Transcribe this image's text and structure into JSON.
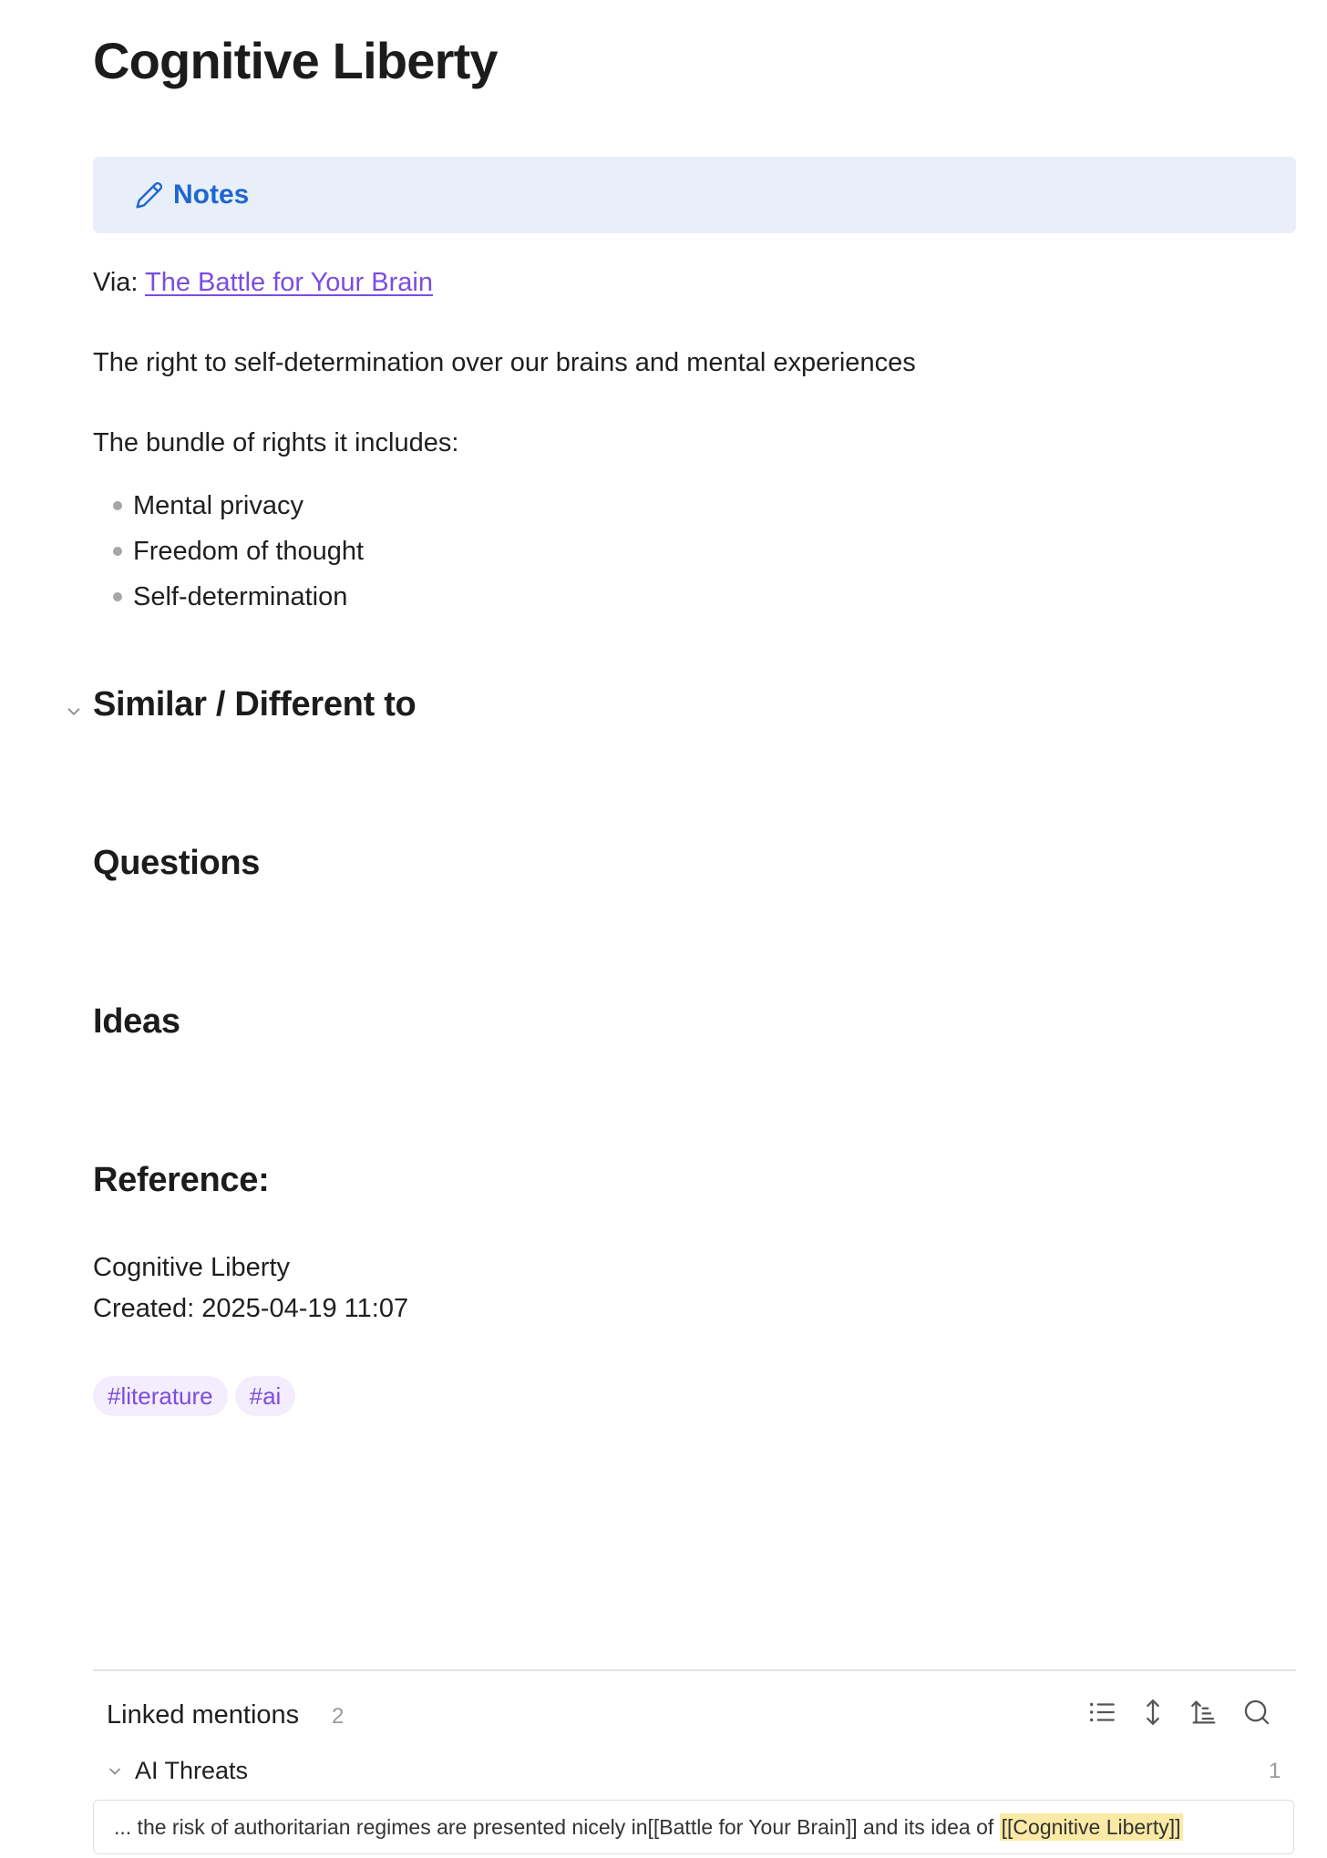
{
  "page": {
    "title": "Cognitive Liberty"
  },
  "callout": {
    "icon": "pencil-icon",
    "title": "Notes",
    "color": "#1e66d0",
    "background": "#e9eff9"
  },
  "body": {
    "via_label": "Via:",
    "via_link": "The Battle for Your Brain",
    "definition": "The right to self-determination over our brains and mental experiences",
    "bundle_intro": "The bundle of rights it includes:",
    "rights": [
      "Mental privacy",
      "Freedom of thought",
      "Self-determination"
    ]
  },
  "sections": {
    "similar": "Similar / Different to",
    "questions": "Questions",
    "ideas": "Ideas",
    "reference": "Reference:"
  },
  "reference": {
    "name": "Cognitive Liberty",
    "created": "Created: 2025-04-19 11:07"
  },
  "tags": [
    "#literature",
    "#ai"
  ],
  "linked_mentions": {
    "title": "Linked mentions",
    "count": "2",
    "toolbar_icons": [
      "list-icon",
      "expand-vertical-icon",
      "sort-icon",
      "search-icon"
    ],
    "group": {
      "title": "AI Threats",
      "count": "1",
      "snippet_before": "... the risk of authoritarian regimes are presented nicely in[[Battle for Your Brain]] and its idea of ",
      "snippet_highlight": "[[Cognitive Liberty]]"
    }
  },
  "colors": {
    "link": "#7b4de0",
    "tag_bg": "#f3edfd",
    "highlight": "#fbeaa5"
  }
}
